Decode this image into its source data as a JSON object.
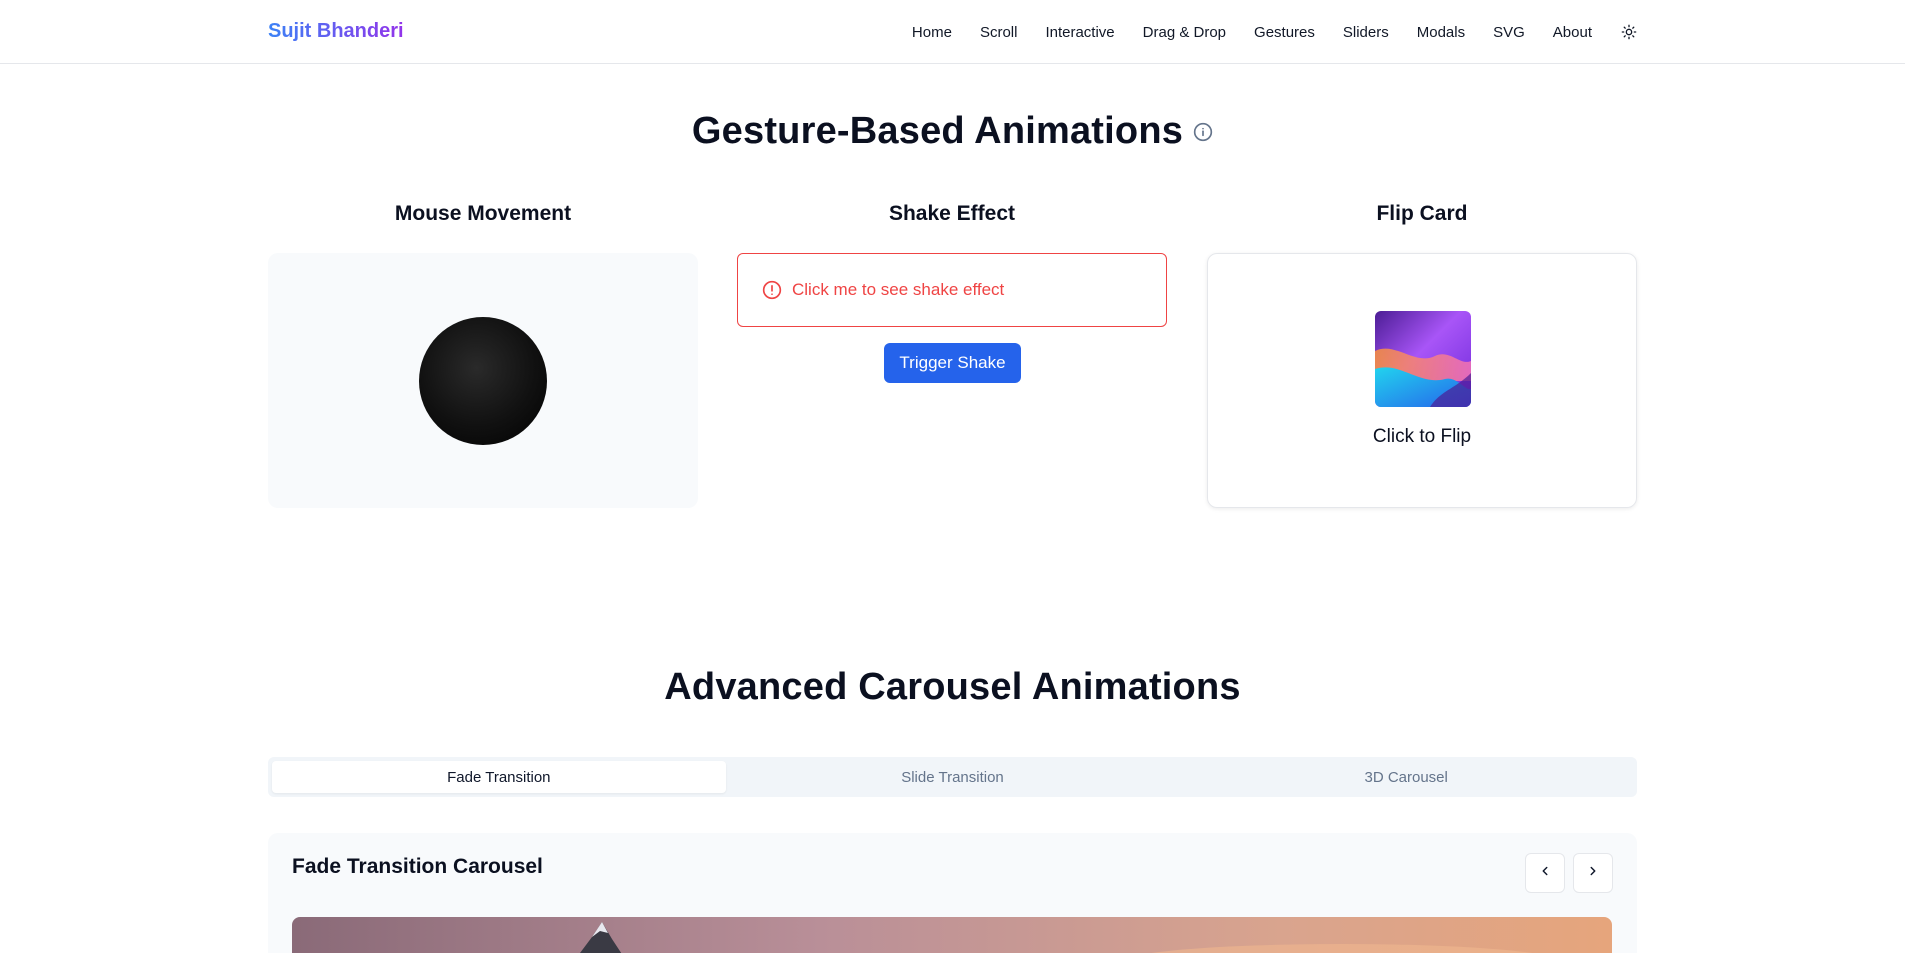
{
  "header": {
    "brand": "Sujit Bhanderi",
    "nav": [
      "Home",
      "Scroll",
      "Interactive",
      "Drag & Drop",
      "Gestures",
      "Sliders",
      "Modals",
      "SVG",
      "About"
    ],
    "theme_icon": "sun-icon"
  },
  "gestures": {
    "title": "Gesture-Based Animations",
    "info_icon": "info-icon",
    "mouse": {
      "title": "Mouse Movement"
    },
    "shake": {
      "title": "Shake Effect",
      "message": "Click me to see shake effect",
      "button": "Trigger Shake",
      "alert_icon": "alert-circle-icon"
    },
    "flip": {
      "title": "Flip Card",
      "label": "Click to Flip"
    }
  },
  "carousel": {
    "title": "Advanced Carousel Animations",
    "tabs": [
      {
        "label": "Fade Transition",
        "active": true
      },
      {
        "label": "Slide Transition",
        "active": false
      },
      {
        "label": "3D Carousel",
        "active": false
      }
    ],
    "panel_title": "Fade Transition Carousel",
    "prev_icon": "chevron-left-icon",
    "next_icon": "chevron-right-icon"
  },
  "colors": {
    "accent": "#2563eb",
    "danger": "#ef4444",
    "brand_gradient": [
      "#3b82f6",
      "#9333ea"
    ]
  }
}
